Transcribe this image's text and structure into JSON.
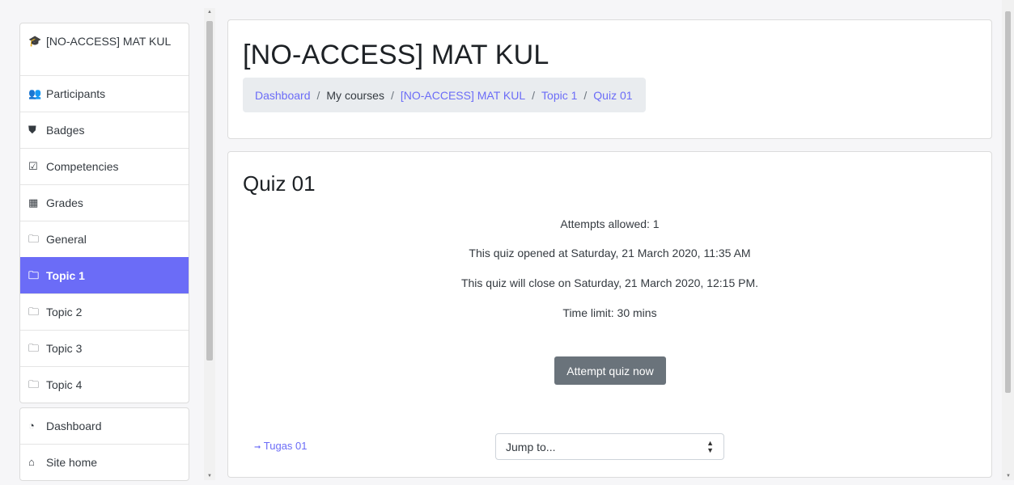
{
  "sidebar": {
    "course_group": [
      {
        "icon": "graduation-cap-icon",
        "glyph": "🎓",
        "label": "[NO-ACCESS] MAT KUL"
      },
      {
        "icon": "users-icon",
        "glyph": "👥",
        "label": "Participants"
      },
      {
        "icon": "shield-icon",
        "glyph": "⛊",
        "label": "Badges"
      },
      {
        "icon": "check-square-icon",
        "glyph": "☑",
        "label": "Competencies"
      },
      {
        "icon": "table-icon",
        "glyph": "▦",
        "label": "Grades"
      },
      {
        "icon": "folder-icon",
        "glyph": "🗀",
        "label": "General"
      },
      {
        "icon": "folder-icon",
        "glyph": "🗀",
        "label": "Topic 1"
      },
      {
        "icon": "folder-icon",
        "glyph": "🗀",
        "label": "Topic 2"
      },
      {
        "icon": "folder-icon",
        "glyph": "🗀",
        "label": "Topic 3"
      },
      {
        "icon": "folder-icon",
        "glyph": "🗀",
        "label": "Topic 4"
      }
    ],
    "site_group": [
      {
        "icon": "dashboard-icon",
        "glyph": "◔",
        "label": "Dashboard"
      },
      {
        "icon": "home-icon",
        "glyph": "⌂",
        "label": "Site home"
      }
    ],
    "active_label": "Topic 1"
  },
  "header": {
    "title": "[NO-ACCESS] MAT KUL",
    "breadcrumb": {
      "dashboard": "Dashboard",
      "my_courses": "My courses",
      "course": "[NO-ACCESS] MAT KUL",
      "topic": "Topic 1",
      "quiz": "Quiz 01",
      "separator": "/"
    }
  },
  "quiz": {
    "title": "Quiz 01",
    "attempts_allowed": "Attempts allowed: 1",
    "opened": "This quiz opened at Saturday, 21 March 2020, 11:35 AM",
    "closes": "This quiz will close on Saturday, 21 March 2020, 12:15 PM.",
    "time_limit": "Time limit: 30 mins",
    "attempt_button": "Attempt quiz now"
  },
  "footer_nav": {
    "prev_arrow": "➞",
    "prev_label": "Tugas 01",
    "jump_placeholder": "Jump to..."
  },
  "colors": {
    "accent": "#6b6cf7",
    "button": "#6a737b",
    "breadcrumb_bg": "#e9ecef"
  }
}
